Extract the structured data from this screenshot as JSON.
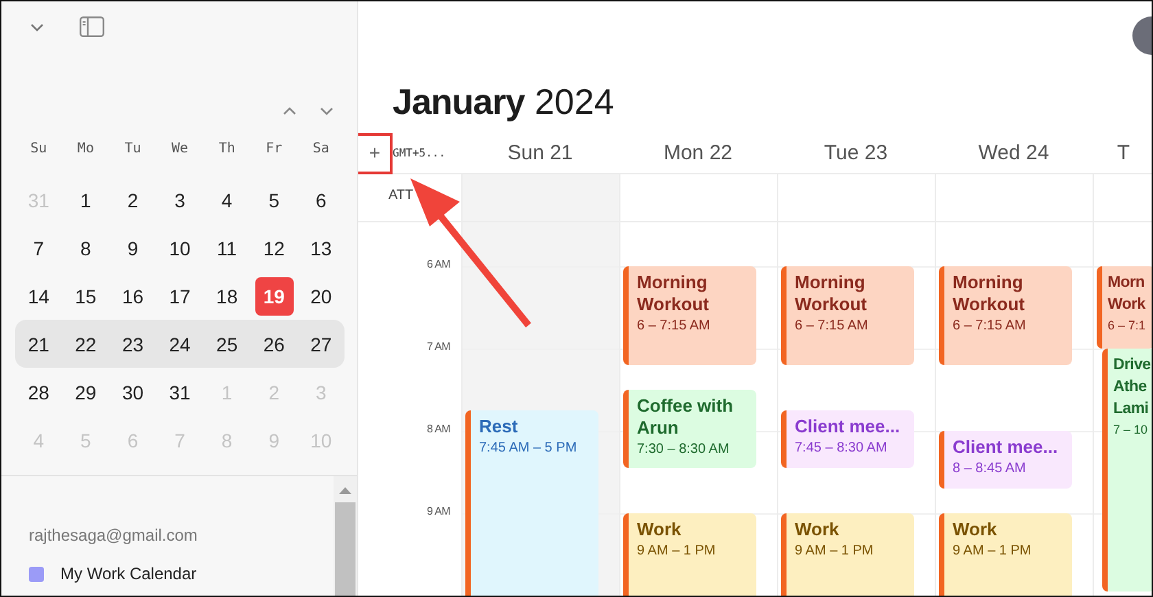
{
  "sidebar": {
    "weekdays": [
      "Su",
      "Mo",
      "Tu",
      "We",
      "Th",
      "Fr",
      "Sa"
    ],
    "weeks": [
      {
        "selected": false,
        "days": [
          {
            "label": "31",
            "outside": true,
            "today": false
          },
          {
            "label": "1",
            "outside": false,
            "today": false
          },
          {
            "label": "2",
            "outside": false,
            "today": false
          },
          {
            "label": "3",
            "outside": false,
            "today": false
          },
          {
            "label": "4",
            "outside": false,
            "today": false
          },
          {
            "label": "5",
            "outside": false,
            "today": false
          },
          {
            "label": "6",
            "outside": false,
            "today": false
          }
        ]
      },
      {
        "selected": false,
        "days": [
          {
            "label": "7",
            "outside": false,
            "today": false
          },
          {
            "label": "8",
            "outside": false,
            "today": false
          },
          {
            "label": "9",
            "outside": false,
            "today": false
          },
          {
            "label": "10",
            "outside": false,
            "today": false
          },
          {
            "label": "11",
            "outside": false,
            "today": false
          },
          {
            "label": "12",
            "outside": false,
            "today": false
          },
          {
            "label": "13",
            "outside": false,
            "today": false
          }
        ]
      },
      {
        "selected": false,
        "days": [
          {
            "label": "14",
            "outside": false,
            "today": false
          },
          {
            "label": "15",
            "outside": false,
            "today": false
          },
          {
            "label": "16",
            "outside": false,
            "today": false
          },
          {
            "label": "17",
            "outside": false,
            "today": false
          },
          {
            "label": "18",
            "outside": false,
            "today": false
          },
          {
            "label": "19",
            "outside": false,
            "today": true
          },
          {
            "label": "20",
            "outside": false,
            "today": false
          }
        ]
      },
      {
        "selected": true,
        "days": [
          {
            "label": "21",
            "outside": false,
            "today": false
          },
          {
            "label": "22",
            "outside": false,
            "today": false
          },
          {
            "label": "23",
            "outside": false,
            "today": false
          },
          {
            "label": "24",
            "outside": false,
            "today": false
          },
          {
            "label": "25",
            "outside": false,
            "today": false
          },
          {
            "label": "26",
            "outside": false,
            "today": false
          },
          {
            "label": "27",
            "outside": false,
            "today": false
          }
        ]
      },
      {
        "selected": false,
        "days": [
          {
            "label": "28",
            "outside": false,
            "today": false
          },
          {
            "label": "29",
            "outside": false,
            "today": false
          },
          {
            "label": "30",
            "outside": false,
            "today": false
          },
          {
            "label": "31",
            "outside": false,
            "today": false
          },
          {
            "label": "1",
            "outside": true,
            "today": false
          },
          {
            "label": "2",
            "outside": true,
            "today": false
          },
          {
            "label": "3",
            "outside": true,
            "today": false
          }
        ]
      },
      {
        "selected": false,
        "days": [
          {
            "label": "4",
            "outside": true,
            "today": false
          },
          {
            "label": "5",
            "outside": true,
            "today": false
          },
          {
            "label": "6",
            "outside": true,
            "today": false
          },
          {
            "label": "7",
            "outside": true,
            "today": false
          },
          {
            "label": "8",
            "outside": true,
            "today": false
          },
          {
            "label": "9",
            "outside": true,
            "today": false
          },
          {
            "label": "10",
            "outside": true,
            "today": false
          }
        ]
      }
    ],
    "account": "rajthesaga@gmail.com",
    "calendars": [
      {
        "name": "My Work Calendar",
        "color": "#9b9bf7"
      }
    ]
  },
  "main": {
    "title": {
      "month": "January",
      "year": "2024"
    },
    "add_button": "+",
    "timezone": "GMT+5...",
    "all_day_label": "ATT",
    "hours": [
      "6 AM",
      "7 AM",
      "8 AM",
      "9 AM"
    ],
    "days": [
      {
        "label": "Sun 21",
        "weekend": true,
        "events": [
          {
            "kind": "rest",
            "title": "Rest",
            "time": "7:45 AM – 5 PM"
          }
        ]
      },
      {
        "label": "Mon 22",
        "weekend": false,
        "events": [
          {
            "kind": "workout",
            "title": "Morning Workout",
            "time": "6 – 7:15 AM"
          },
          {
            "kind": "social",
            "title": "Coffee with Arun",
            "time": "7:30 – 8:30 AM"
          },
          {
            "kind": "work",
            "title": "Work",
            "time": "9 AM – 1 PM"
          }
        ]
      },
      {
        "label": "Tue 23",
        "weekend": false,
        "events": [
          {
            "kind": "workout",
            "title": "Morning Workout",
            "time": "6 – 7:15 AM"
          },
          {
            "kind": "meeting",
            "title": "Client mee...",
            "time": "7:45 – 8:30 AM"
          },
          {
            "kind": "work",
            "title": "Work",
            "time": "9 AM – 1 PM"
          }
        ]
      },
      {
        "label": "Wed 24",
        "weekend": false,
        "events": [
          {
            "kind": "workout",
            "title": "Morning Workout",
            "time": "6 – 7:15 AM"
          },
          {
            "kind": "meeting",
            "title": "Client mee...",
            "time": "8 – 8:45 AM"
          },
          {
            "kind": "work",
            "title": "Work",
            "time": "9 AM – 1 PM"
          }
        ]
      },
      {
        "label": "T",
        "weekend": false,
        "events": [
          {
            "kind": "workout",
            "title": "Morn Work",
            "time": "6 – 7:1"
          },
          {
            "kind": "social",
            "title": "Drive Athe Lami",
            "time": "7 – 10"
          }
        ]
      }
    ]
  }
}
